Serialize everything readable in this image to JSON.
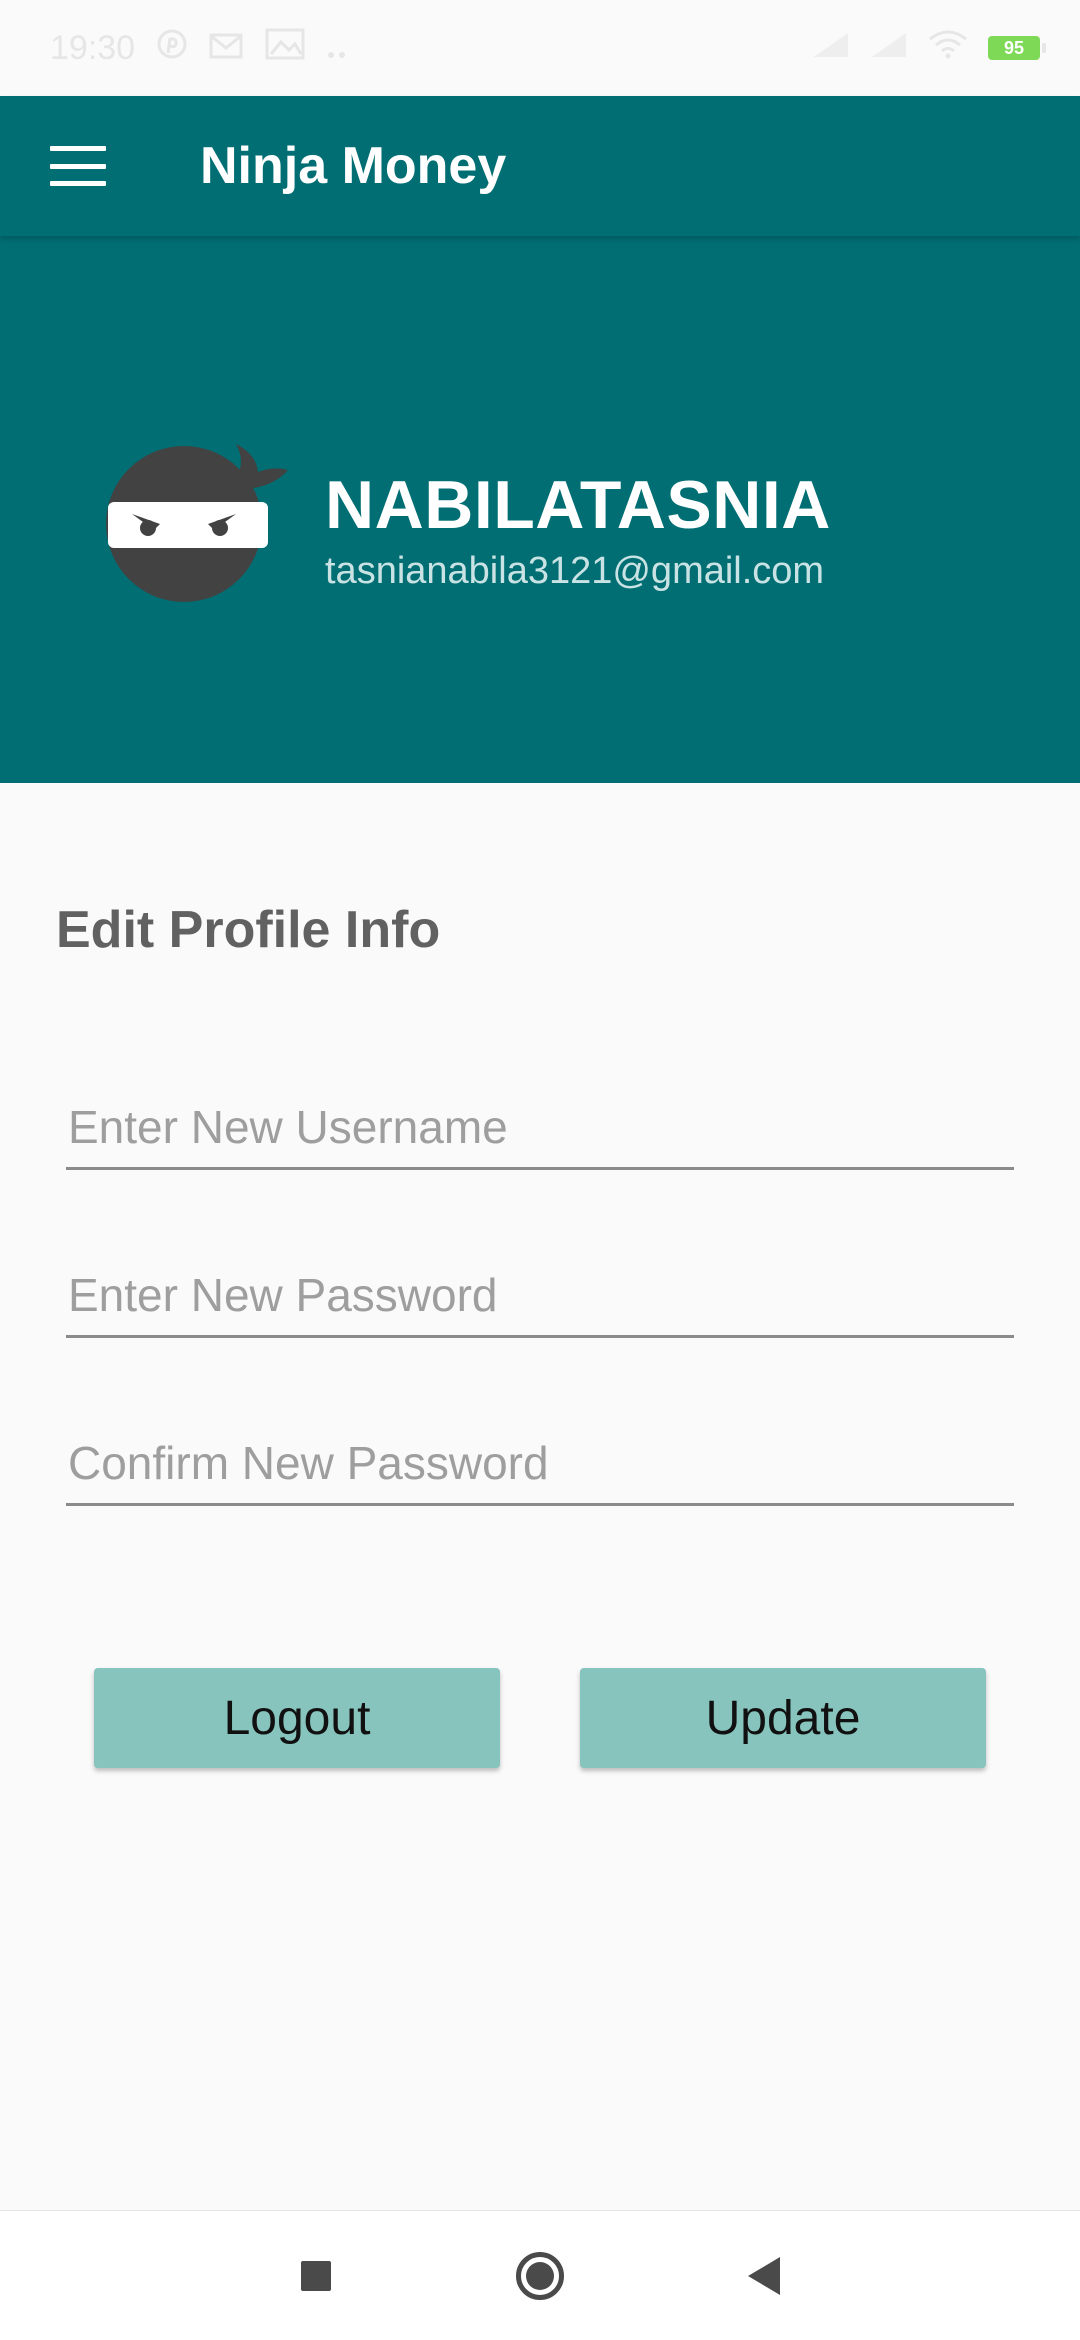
{
  "status_bar": {
    "time": "19:30",
    "battery_level": "95",
    "icons": [
      "pinterest-icon",
      "gmail-icon",
      "gallery-icon",
      "more-dots-icon",
      "signal-icon",
      "signal-icon",
      "wifi-icon",
      "battery-icon"
    ]
  },
  "app_bar": {
    "title": "Ninja Money",
    "menu_icon": "hamburger-menu-icon"
  },
  "profile": {
    "username": "NABILATASNIA",
    "email": "tasnianabila3121@gmail.com",
    "avatar_icon": "ninja-avatar-icon"
  },
  "form": {
    "title": "Edit Profile Info",
    "username_placeholder": "Enter New Username",
    "password_placeholder": "Enter New Password",
    "confirm_placeholder": "Confirm New Password",
    "username_value": "",
    "password_value": "",
    "confirm_value": ""
  },
  "buttons": {
    "logout_label": "Logout",
    "update_label": "Update"
  },
  "colors": {
    "primary": "#006e73",
    "button": "#86c4bd",
    "background": "#fafafa"
  },
  "nav_bar": {
    "icons": [
      "recents-square-icon",
      "home-circle-icon",
      "back-triangle-icon"
    ]
  }
}
